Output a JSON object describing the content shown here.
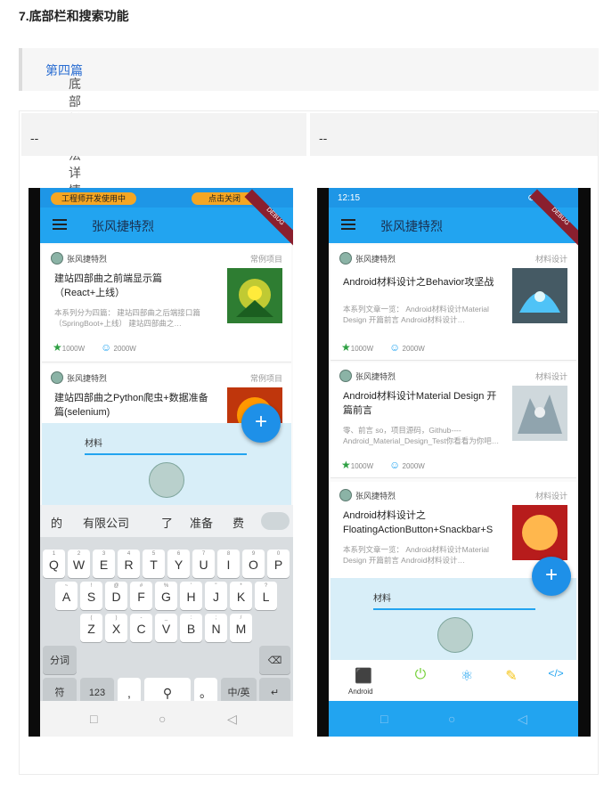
{
  "heading": "7.底部栏和搜索功能",
  "quote": {
    "prefix": "底部栏用法详情在",
    "link": "第四篇"
  },
  "table": {
    "col1": "--",
    "col2": "--"
  },
  "phone1": {
    "status": {
      "left_pill": "工程师开发使用中",
      "right_pill": "点击关闭"
    },
    "ribbon": "DEBUG",
    "app_title": "张风捷特烈",
    "cards": [
      {
        "author": "张风捷特烈",
        "category": "常例项目",
        "title": "建站四部曲之前端显示篇（React+上线）",
        "desc": "本系列分为四篇： 建站四部曲之后端接口篇（SpringBoot+上线） 建站四部曲之…",
        "stars": "1000W",
        "likes": "2000W"
      },
      {
        "author": "张风捷特烈",
        "category": "常例项目",
        "title": "建站四部曲之Python爬虫+数据准备篇(selenium)"
      }
    ],
    "sheet": {
      "label": "材料"
    },
    "fab": "+",
    "suggestions": [
      "的",
      "有限公司",
      "了",
      "准备",
      "费"
    ],
    "keys_row1": [
      {
        "k": "Q",
        "s": "1"
      },
      {
        "k": "W",
        "s": "2"
      },
      {
        "k": "E",
        "s": "3"
      },
      {
        "k": "R",
        "s": "4"
      },
      {
        "k": "T",
        "s": "5"
      },
      {
        "k": "Y",
        "s": "6"
      },
      {
        "k": "U",
        "s": "7"
      },
      {
        "k": "I",
        "s": "8"
      },
      {
        "k": "O",
        "s": "9"
      },
      {
        "k": "P",
        "s": "0"
      }
    ],
    "keys_row2": [
      {
        "k": "A",
        "s": "~"
      },
      {
        "k": "S",
        "s": "!"
      },
      {
        "k": "D",
        "s": "@"
      },
      {
        "k": "F",
        "s": "#"
      },
      {
        "k": "G",
        "s": "%"
      },
      {
        "k": "H",
        "s": "'"
      },
      {
        "k": "J",
        "s": "\""
      },
      {
        "k": "K",
        "s": "*"
      },
      {
        "k": "L",
        "s": "?"
      }
    ],
    "keys_row3": [
      {
        "k": "Z",
        "s": "("
      },
      {
        "k": "X",
        "s": ")"
      },
      {
        "k": "C",
        "s": "-"
      },
      {
        "k": "V",
        "s": "_"
      },
      {
        "k": "B",
        "s": ":"
      },
      {
        "k": "N",
        "s": ";"
      },
      {
        "k": "M",
        "s": "/"
      }
    ],
    "key_fenci": "分词",
    "key_fu": "符",
    "key_123": "123",
    "key_comma": ",",
    "key_period": "。",
    "key_lang": "中/英",
    "key_backspace": "⌫",
    "key_enter": "↵",
    "key_mic": "⚲",
    "nav": {
      "back": "◁",
      "home": "○",
      "recent": "□"
    }
  },
  "phone2": {
    "status": {
      "time": "12:15",
      "icons": "⊘ ▮"
    },
    "ribbon": "DEBUG",
    "app_title": "张风捷特烈",
    "cards": [
      {
        "author": "张风捷特烈",
        "category": "材料设计",
        "title": "Android材料设计之Behavior攻坚战",
        "desc": "本系列文章一览： Android材料设计Material Design 开篇前言 Android材料设计…",
        "stars": "1000W",
        "likes": "2000W"
      },
      {
        "author": "张风捷特烈",
        "category": "材料设计",
        "title": "Android材料设计Material Design 开篇前言",
        "desc": "零、前言 so，项目源码，Github---- Android_Material_Design_Test你看看为你吧…",
        "stars": "1000W",
        "likes": "2000W"
      },
      {
        "author": "张风捷特烈",
        "category": "材料设计",
        "title": "Android材料设计之FloatingActionButton+Snackbar+S",
        "desc": "本系列文章一览： Android材料设计Material Design 开篇前言 Android材料设计…"
      }
    ],
    "sheet": {
      "label": "材料"
    },
    "fab": "+",
    "bottom_nav": {
      "android_label": "Android",
      "android_icon": "android-icon",
      "power_icon": "power-icon",
      "react_icon": "react-icon",
      "note_icon": "note-icon",
      "code_icon": "code-icon"
    },
    "nav": {
      "back": "◁",
      "home": "○",
      "recent": "□"
    }
  },
  "colors": {
    "primary": "#22a4f0",
    "fab": "#1e90e8",
    "star": "#2ea043",
    "link": "#2b6ed2"
  }
}
